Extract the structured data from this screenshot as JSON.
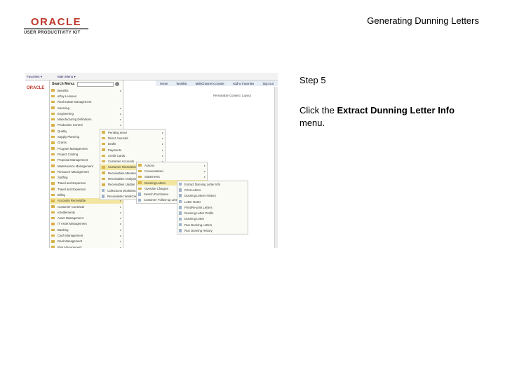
{
  "logo": {
    "brand": "ORACLE",
    "subtitle": "USER PRODUCTIVITY KIT"
  },
  "header": {
    "title": "Generating Dunning Letters"
  },
  "step": {
    "label": "Step 5"
  },
  "instruction": {
    "prefix": "Click the ",
    "emphasis": "Extract Dunning Letter Info",
    "suffix": " menu."
  },
  "screenshot": {
    "topbar": {
      "favorites": "Favorites ▾",
      "main_menu": "Main Menu ▾"
    },
    "nav_links": [
      "Home",
      "Worklist",
      "MultiChannel Console",
      "Add to Favorites",
      "Sign out"
    ],
    "oracle_small": "ORACLE",
    "personalize": "Personalize Content | Layout",
    "search_label": "Search Menu:",
    "main_menu": [
      {
        "label": "Benefits",
        "arrow": true
      },
      {
        "label": "ePay Lessees",
        "arrow": false
      },
      {
        "label": "Real Estate Management",
        "arrow": false
      },
      {
        "label": "Sourcing",
        "arrow": true
      },
      {
        "label": "Engineering",
        "arrow": true
      },
      {
        "label": "Manufacturing Definitions",
        "arrow": true
      },
      {
        "label": "Production Control",
        "arrow": true
      },
      {
        "label": "Quality",
        "arrow": true
      },
      {
        "label": "Supply Planning",
        "arrow": true
      },
      {
        "label": "Grants",
        "arrow": true
      },
      {
        "label": "Program Management",
        "arrow": true
      },
      {
        "label": "Project Costing",
        "arrow": true
      },
      {
        "label": "Proposal Management",
        "arrow": true
      },
      {
        "label": "Maintenance Management",
        "arrow": true
      },
      {
        "label": "Resource Management",
        "arrow": true
      },
      {
        "label": "Staffing",
        "arrow": true
      },
      {
        "label": "Travel and Expenses",
        "arrow": true
      },
      {
        "label": "Travel and Expenses",
        "arrow": true
      },
      {
        "label": "Billing",
        "arrow": true
      },
      {
        "label": "Accounts Receivable",
        "arrow": true
      },
      {
        "label": "Customer Contracts",
        "arrow": true
      },
      {
        "label": "eSettlements",
        "arrow": true
      },
      {
        "label": "Asset Management",
        "arrow": true
      },
      {
        "label": "IT Asset Management",
        "arrow": true
      },
      {
        "label": "Banking",
        "arrow": true
      },
      {
        "label": "Cash Management",
        "arrow": true
      },
      {
        "label": "Deal Management",
        "arrow": true
      },
      {
        "label": "Risk Management",
        "arrow": true
      }
    ],
    "sub_menu_1": [
      {
        "label": "Pending Items",
        "arrow": true
      },
      {
        "label": "Direct Journals",
        "arrow": true
      },
      {
        "label": "Drafts",
        "arrow": true
      },
      {
        "label": "Payments",
        "arrow": true
      },
      {
        "label": "Credit Cards",
        "arrow": true
      },
      {
        "label": "Customer Accounts",
        "arrow": true
      },
      {
        "label": "Customer Interactions",
        "arrow": true
      },
      {
        "label": "Receivables Maintenance",
        "arrow": true
      },
      {
        "label": "Receivables Analysis",
        "arrow": true
      },
      {
        "label": "Receivables Update",
        "arrow": true
      },
      {
        "label": "Collections Workbench",
        "arrow": false
      },
      {
        "label": "Receivables WorkCenter",
        "arrow": false
      }
    ],
    "sub_menu_2": [
      {
        "label": "Actions",
        "arrow": true
      },
      {
        "label": "Conversations",
        "arrow": true
      },
      {
        "label": "Statements",
        "arrow": true
      },
      {
        "label": "Dunning Letters",
        "arrow": true
      },
      {
        "label": "Overdue Charges",
        "arrow": true
      },
      {
        "label": "Search Purchases",
        "arrow": false
      },
      {
        "label": "Customer Follow-up Letters",
        "arrow": false
      }
    ],
    "sub_menu_3": [
      {
        "label": "Extract Dunning Letter Info",
        "arrow": false
      },
      {
        "label": "Print Letters",
        "arrow": false
      },
      {
        "label": "Dunning Letters History",
        "arrow": false
      },
      {
        "label": "Letter Notes",
        "arrow": false
      },
      {
        "label": "Print/Re-print Letters",
        "arrow": false
      },
      {
        "label": "Dunning Letter Profile",
        "arrow": false
      },
      {
        "label": "Dunning Letter",
        "arrow": false
      },
      {
        "label": "Run Dunning Letters",
        "arrow": false
      },
      {
        "label": "Run Dunning History",
        "arrow": false
      }
    ],
    "colors": {
      "highlight": "#f2e6a0",
      "callout": "#e0231b",
      "folder": "#d8b24a"
    }
  }
}
